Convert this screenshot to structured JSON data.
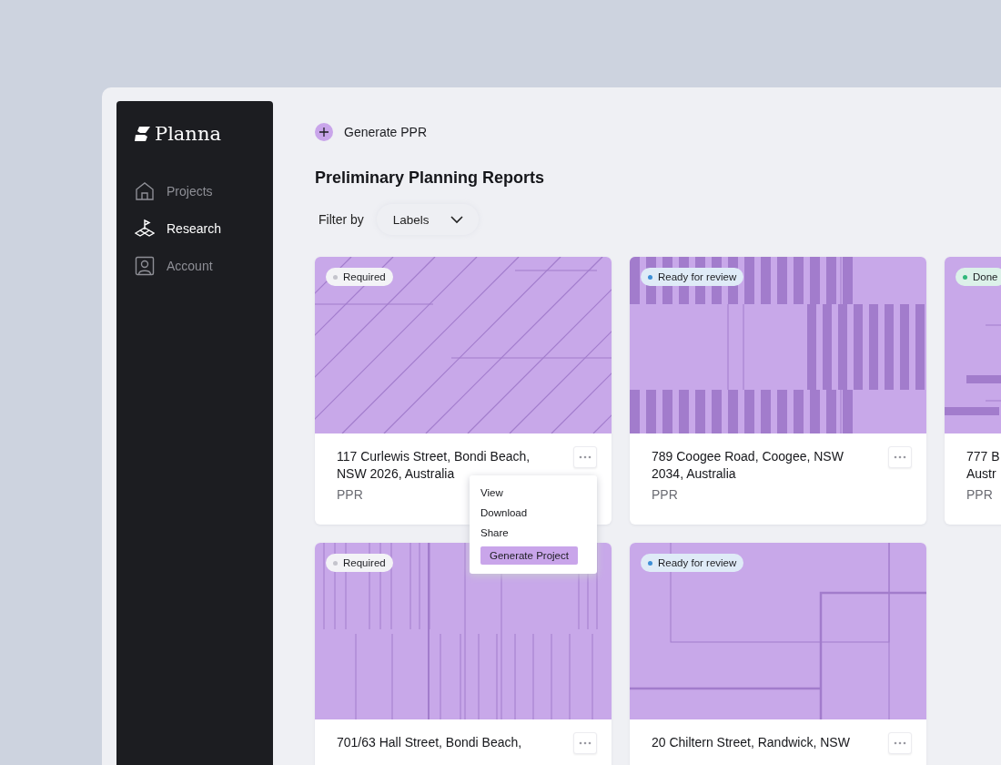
{
  "brand": {
    "name": "Planna"
  },
  "sidebar": {
    "items": [
      {
        "label": "Projects",
        "selected": false
      },
      {
        "label": "Research",
        "selected": true
      },
      {
        "label": "Account",
        "selected": false
      }
    ]
  },
  "action_button": {
    "label": "Generate PPR"
  },
  "page_title": "Preliminary Planning Reports",
  "filter": {
    "label": "Filter by",
    "dropdown": "Labels"
  },
  "cards": [
    {
      "badge": "Required",
      "color": "#c4c4cc",
      "kind": "diagonal",
      "title_lines": [
        "117 Curlewis Street, Bondi Beach,",
        "NSW 2026, Australia"
      ],
      "type": "PPR",
      "more_button": true,
      "menu": {
        "items": [
          "View",
          "Download",
          "Share"
        ],
        "action": "Generate Project"
      }
    },
    {
      "badge": "Ready for review",
      "color": "#3d8fd6",
      "kind": "piano",
      "title_lines": [
        "789 Coogee Road, Coogee, NSW",
        "2034, Australia"
      ],
      "type": "PPR",
      "more_button": true
    },
    {
      "badge": "Done",
      "color": "#2fb87a",
      "kind": "bars",
      "title_lines": [
        "777 B",
        "Austr"
      ],
      "type": "PPR"
    },
    {
      "badge": "Required",
      "color": "#c4c4cc",
      "kind": "verticals",
      "title_lines": [
        "701/63 Hall Street, Bondi Beach,"
      ],
      "more_button": true
    },
    {
      "badge": "Ready for review",
      "color": "#3d8fd6",
      "kind": "frames",
      "title_lines": [
        "20 Chiltern Street, Randwick, NSW"
      ],
      "more_button": true
    }
  ]
}
